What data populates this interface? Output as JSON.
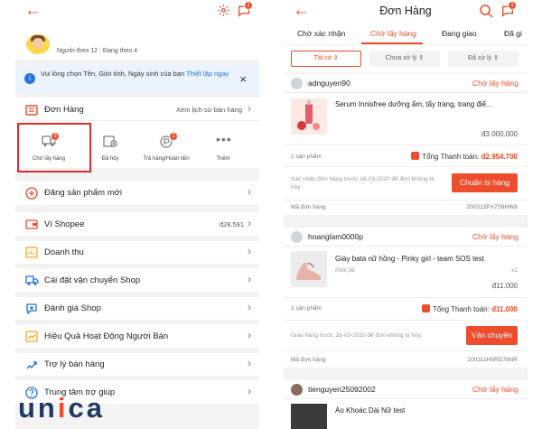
{
  "colors": {
    "accent": "#ee4d2d",
    "link": "#2673dd"
  },
  "left": {
    "header": {
      "back_icon": "back-arrow-icon",
      "settings_icon": "gear-icon",
      "chat_icon": "chat-icon",
      "chat_badge": "1"
    },
    "profile": {
      "followers": "Người theo 12",
      "following": "Đang theo 4"
    },
    "notice": {
      "text": "Vui lòng chọn Tên, Giới tính, Ngày sinh của bạn ",
      "link": "Thiết lập ngay"
    },
    "orders": {
      "title": "Đơn Hàng",
      "history_link": "Xem lịch sử bán hàng"
    },
    "order_tiles": [
      {
        "label": "Chờ lấy hàng",
        "badge": "3",
        "icon": "truck-icon"
      },
      {
        "label": "Đã hủy",
        "badge": "",
        "icon": "cancel-box-icon"
      },
      {
        "label": "Trả hàng/Hoàn tiền",
        "badge": "1",
        "icon": "refund-icon"
      },
      {
        "label": "Thêm",
        "badge": "",
        "icon": "more-icon"
      }
    ],
    "post_product": "Đăng sản phẩm mới",
    "menu": [
      {
        "label": "Ví Shopee",
        "value": "đ28.591",
        "icon": "wallet-icon"
      },
      {
        "label": "Doanh thu",
        "value": "",
        "icon": "revenue-icon"
      },
      {
        "label": "Cài đặt vận chuyển Shop",
        "value": "",
        "icon": "shipping-icon"
      },
      {
        "label": "Đánh giá Shop",
        "value": "",
        "icon": "rating-icon"
      },
      {
        "label": "Hiệu Quả Hoạt Động Người Bán",
        "value": "",
        "icon": "performance-icon"
      },
      {
        "label": "Trợ lý bán hàng",
        "value": "",
        "icon": "assistant-icon"
      },
      {
        "label": "Trung tâm trợ giúp",
        "value": "",
        "icon": "help-icon"
      }
    ]
  },
  "right": {
    "header": {
      "title": "Đơn Hàng",
      "chat_badge": "1"
    },
    "tabs": [
      "Chờ xác nhận",
      "Chờ lấy hàng",
      "Đang giao",
      "Đã gi"
    ],
    "filters": [
      "Tất cả",
      "Chưa xử lý",
      "Đã xử lý"
    ],
    "orders": [
      {
        "user": "adnguyen90",
        "status": "Chờ lấy hàng",
        "product": "Serum Innisfree dưỡng ẩm, tẩy trang, trang điể...",
        "variant": "",
        "qty": "",
        "price": "đ3.000.000",
        "count": "1 sản phẩm",
        "total_label": "Tổng Thanh toán:",
        "total": "đ2.954.700",
        "note": "Xác nhận đơn hàng trước 16-03-2020 để đơn không bị hủy.",
        "action": "Chuẩn bị hàng",
        "code_label": "Mã đơn hàng",
        "code": "200313PX7S9HW8"
      },
      {
        "user": "hoanglam0000p",
        "status": "Chờ lấy hàng",
        "product": "Giày bata nữ hồng - Pinky girl - team SOS test",
        "variant": "Pink,38",
        "qty": "x1",
        "price": "đ11.000",
        "count": "1 sản phẩm",
        "total_label": "Tổng Thanh toán:",
        "total": "đ11.000",
        "note": "Giao hàng trước 16-03-2020 để đơn không bị hủy.",
        "action": "Vận chuyển",
        "code_label": "Mã đơn hàng",
        "code": "200311H5RD78NR"
      },
      {
        "user": "tienguyen25092002",
        "status": "Chờ lấy hàng",
        "product": "Áo Khoác Dài Nữ test"
      }
    ]
  },
  "watermark": {
    "a": "un",
    "b": "i",
    "c": "ca"
  }
}
